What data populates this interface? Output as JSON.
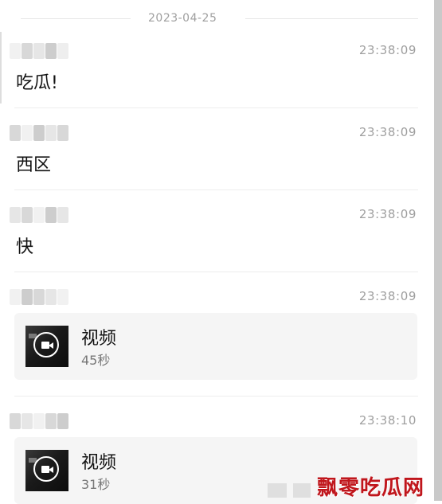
{
  "date_separator": "2023-04-25",
  "messages": [
    {
      "time": "23:38:09",
      "text": "吃瓜!"
    },
    {
      "time": "23:38:09",
      "text": "西区"
    },
    {
      "time": "23:38:09",
      "text": "快"
    },
    {
      "time": "23:38:09",
      "card": {
        "title": "视频",
        "duration": "45秒"
      }
    },
    {
      "time": "23:38:10",
      "card": {
        "title": "视频",
        "duration": "31秒"
      }
    }
  ],
  "watermark": "飘零吃瓜网",
  "icons": {
    "video_thumbnail": "video-camera-icon"
  },
  "colors": {
    "background": "#ffffff",
    "timestamp": "#9f9f9f",
    "card_background": "#f5f5f5",
    "watermark": "#c0161c"
  }
}
